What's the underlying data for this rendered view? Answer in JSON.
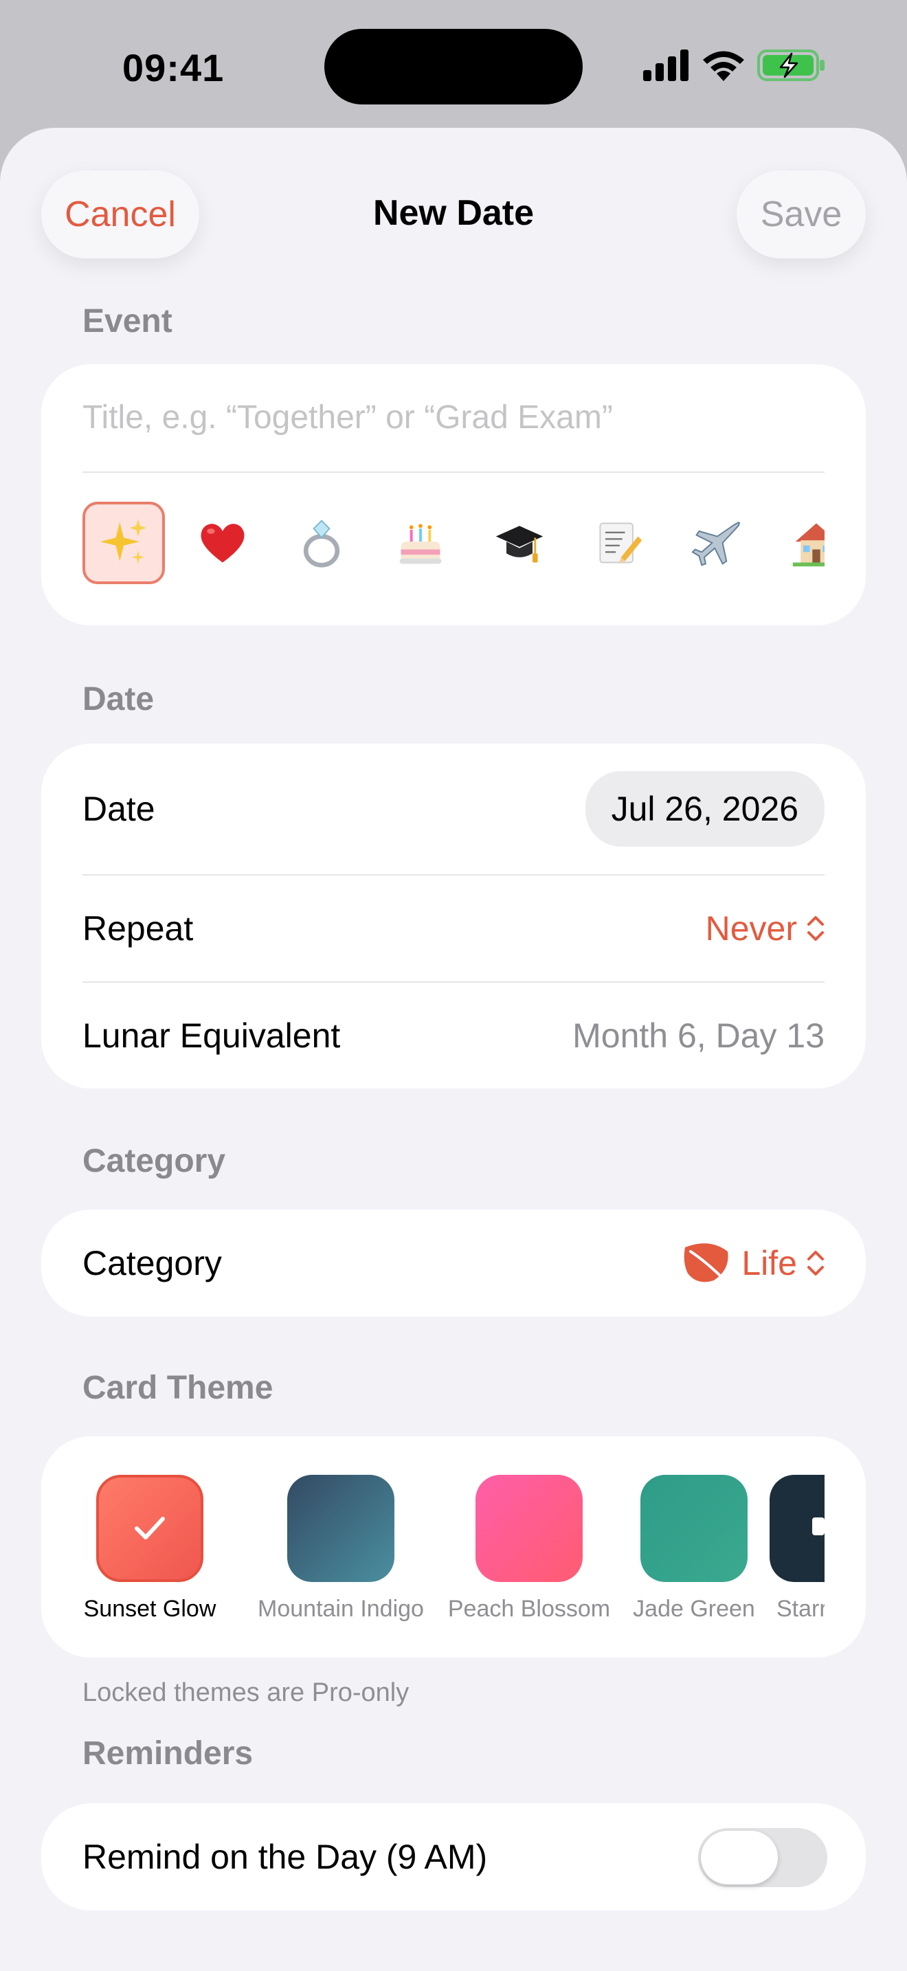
{
  "status": {
    "time": "09:41"
  },
  "nav": {
    "cancel": "Cancel",
    "title": "New Date",
    "save": "Save"
  },
  "event": {
    "section": "Event",
    "title_placeholder": "Title, e.g. “Together” or “Grad Exam”",
    "icons": [
      "sparkles-icon",
      "heart-icon",
      "ring-icon",
      "birthday-cake-icon",
      "graduation-cap-icon",
      "memo-icon",
      "airplane-icon",
      "house-icon"
    ],
    "selected_icon": "sparkles-icon"
  },
  "date": {
    "section": "Date",
    "date_label": "Date",
    "date_value": "Jul 26, 2026",
    "repeat_label": "Repeat",
    "repeat_value": "Never",
    "lunar_label": "Lunar Equivalent",
    "lunar_value": "Month 6, Day 13"
  },
  "category": {
    "section": "Category",
    "label": "Category",
    "value": "Life"
  },
  "theme": {
    "section": "Card Theme",
    "items": [
      {
        "name": "Sunset Glow",
        "selected": true,
        "colors": [
          "#ff7b68",
          "#f0574f"
        ]
      },
      {
        "name": "Mountain Indigo",
        "selected": false,
        "colors": [
          "#334a63",
          "#4a8fa0"
        ]
      },
      {
        "name": "Peach Blossom",
        "selected": false,
        "colors": [
          "#ff5ea8",
          "#ff5c72"
        ]
      },
      {
        "name": "Jade Green",
        "selected": false,
        "colors": [
          "#2e9c88",
          "#3aa98f"
        ]
      },
      {
        "name": "Starry",
        "selected": false,
        "colors": [
          "#1c2e3b",
          "#1c2e3b"
        ]
      }
    ],
    "footnote": "Locked themes are Pro-only"
  },
  "reminders": {
    "section": "Reminders",
    "label": "Remind on the Day (9 AM)",
    "enabled": false
  },
  "colors": {
    "accent": "#e35a3f",
    "background": "#f2f2f7",
    "secondary_text": "#8e8e93"
  }
}
